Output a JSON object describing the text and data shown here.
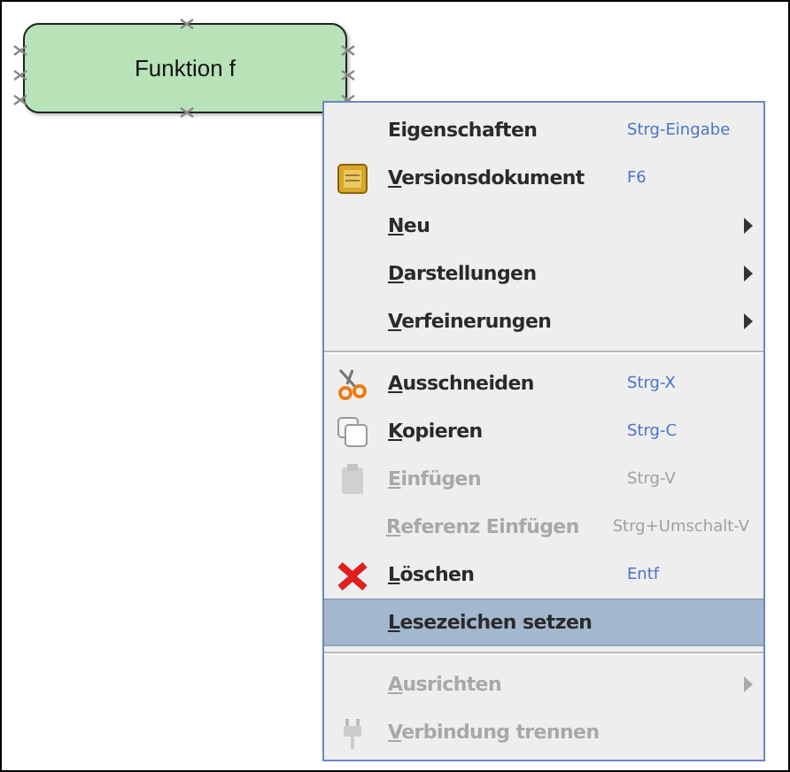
{
  "canvas": {
    "node": {
      "label": "Funktion f"
    }
  },
  "context_menu": {
    "items": [
      {
        "kind": "item",
        "label": "Eigenschaften",
        "mnemonic": false,
        "shortcut": "Strg-Eingabe",
        "disabled": false,
        "selected": false
      },
      {
        "kind": "item",
        "label": "Versionsdokument",
        "mnemonic": true,
        "shortcut": "F6",
        "disabled": false,
        "selected": false
      },
      {
        "kind": "submenu",
        "label": "Neu",
        "mnemonic": true,
        "disabled": false,
        "selected": false
      },
      {
        "kind": "submenu",
        "label": "Darstellungen",
        "mnemonic": true,
        "disabled": false,
        "selected": false
      },
      {
        "kind": "submenu",
        "label": "Verfeinerungen",
        "mnemonic": true,
        "disabled": false,
        "selected": false
      },
      {
        "kind": "separator"
      },
      {
        "kind": "item",
        "label": "Ausschneiden",
        "mnemonic": true,
        "shortcut": "Strg-X",
        "disabled": false,
        "selected": false
      },
      {
        "kind": "item",
        "label": "Kopieren",
        "mnemonic": true,
        "shortcut": "Strg-C",
        "disabled": false,
        "selected": false
      },
      {
        "kind": "item",
        "label": "Einfügen",
        "mnemonic": true,
        "shortcut": "Strg-V",
        "disabled": true,
        "selected": false
      },
      {
        "kind": "item",
        "label": "Referenz Einfügen",
        "mnemonic": true,
        "shortcut": "Strg+Umschalt-V",
        "disabled": true,
        "selected": false
      },
      {
        "kind": "item",
        "label": "Löschen",
        "mnemonic": true,
        "shortcut": "Entf",
        "disabled": false,
        "selected": false
      },
      {
        "kind": "item",
        "label": "Lesezeichen setzen",
        "mnemonic": true,
        "disabled": false,
        "selected": true
      },
      {
        "kind": "separator"
      },
      {
        "kind": "submenu",
        "label": "Ausrichten",
        "mnemonic": true,
        "disabled": true,
        "selected": false
      },
      {
        "kind": "item",
        "label": "Verbindung trennen",
        "mnemonic": true,
        "disabled": true,
        "selected": false
      }
    ]
  }
}
